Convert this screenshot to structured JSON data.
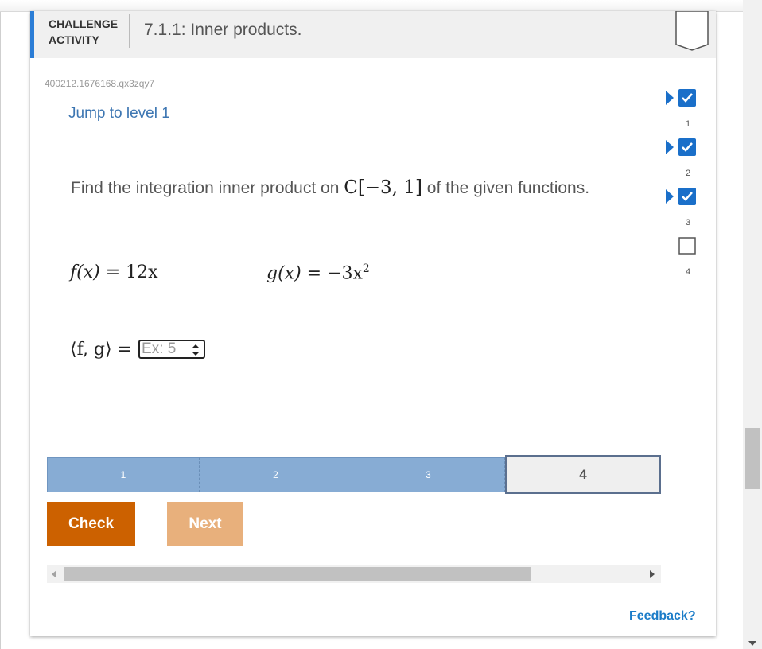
{
  "header": {
    "kind_line1": "CHALLENGE",
    "kind_line2": "ACTIVITY",
    "title": "7.1.1: Inner products."
  },
  "activity_id": "400212.1676168.qx3zqy7",
  "jump_link": "Jump to level 1",
  "prompt": {
    "before": "Find the integration inner product on ",
    "math": "C[−3, 1]",
    "after": " of the given functions."
  },
  "functions": {
    "f_lhs": "f(x)",
    "f_rhs": "= 12x",
    "g_lhs": "g(x)",
    "g_rhs": "= −3x",
    "g_exp": "2"
  },
  "answer": {
    "label": "⟨f, g⟩ =",
    "placeholder": "Ex: 5",
    "value": ""
  },
  "levels": [
    {
      "label": "1",
      "state": "done"
    },
    {
      "label": "2",
      "state": "done"
    },
    {
      "label": "3",
      "state": "done"
    },
    {
      "label": "4",
      "state": "current"
    }
  ],
  "buttons": {
    "check": "Check",
    "next": "Next"
  },
  "feedback": "Feedback?",
  "progress_steps": [
    {
      "label": "1",
      "completed": true
    },
    {
      "label": "2",
      "completed": true
    },
    {
      "label": "3",
      "completed": true
    },
    {
      "label": "4",
      "completed": false
    }
  ],
  "colors": {
    "accent": "#2b7dd6",
    "check_button": "#cc6100",
    "next_button": "#e8b07c",
    "level_done": "#87acd4",
    "link": "#3d76b2",
    "feedback": "#1b7cc8",
    "step_complete": "#1a6fc9"
  }
}
